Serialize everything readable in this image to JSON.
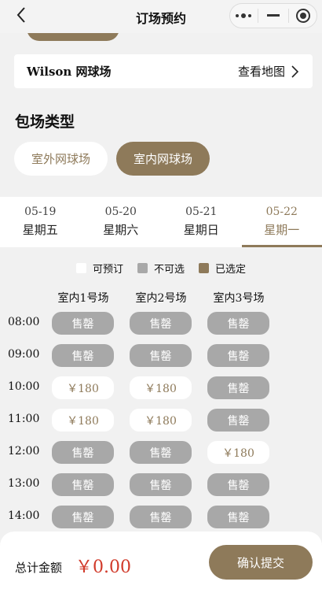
{
  "header": {
    "title": "订场预约"
  },
  "venue": {
    "name": "Wilson 网球场",
    "map_link": "查看地图"
  },
  "section": {
    "title": "包场类型",
    "types": [
      {
        "label": "室外网球场",
        "selected": false
      },
      {
        "label": "室内网球场",
        "selected": true
      }
    ]
  },
  "dates": [
    {
      "date": "05-19",
      "weekday": "星期五",
      "active": false
    },
    {
      "date": "05-20",
      "weekday": "星期六",
      "active": false
    },
    {
      "date": "05-21",
      "weekday": "星期日",
      "active": false
    },
    {
      "date": "05-22",
      "weekday": "星期一",
      "active": true
    }
  ],
  "legend": {
    "available": "可预订",
    "unavailable": "不可选",
    "selected": "已选定"
  },
  "courts": [
    "室内1号场",
    "室内2号场",
    "室内3号场"
  ],
  "times": [
    "08:00",
    "09:00",
    "10:00",
    "11:00",
    "12:00",
    "13:00",
    "14:00"
  ],
  "slots": [
    [
      "售罄",
      "售罄",
      "售罄"
    ],
    [
      "售罄",
      "售罄",
      "售罄"
    ],
    [
      "￥180",
      "￥180",
      "售罄"
    ],
    [
      "￥180",
      "￥180",
      "售罄"
    ],
    [
      "售罄",
      "售罄",
      "￥180"
    ],
    [
      "售罄",
      "售罄",
      "售罄"
    ],
    [
      "售罄",
      "售罄",
      "售罄"
    ]
  ],
  "footer": {
    "total_label": "总计金额",
    "total_value": "￥0.00",
    "submit_label": "确认提交"
  },
  "colors": {
    "accent": "#8e7a5a",
    "sold": "#a8a8a8",
    "price_red": "#d13a2a"
  }
}
